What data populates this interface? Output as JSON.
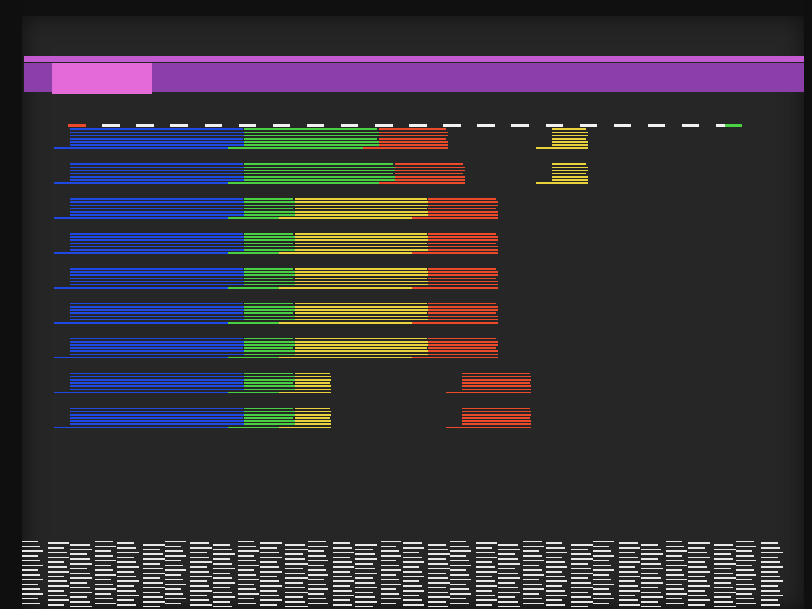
{
  "screen": {
    "title_bar": {
      "accent_color": "#c45ad0",
      "band_color": "#8c3fa8",
      "active_block_color": "#e36ad8"
    }
  },
  "colors": {
    "blue": "#1f49e6",
    "green": "#49d043",
    "yellow": "#e9d23b",
    "red": "#ec4a2a",
    "dash": "#f2f2f2",
    "background": "#262626"
  },
  "chart_data": {
    "type": "bar",
    "title": "",
    "xlabel": "",
    "ylabel": "",
    "stacked": true,
    "rows": [
      {
        "segments": [
          {
            "color": "blue",
            "start": 0,
            "length": 220
          },
          {
            "color": "green",
            "start": 220,
            "length": 170
          },
          {
            "color": "red",
            "start": 390,
            "length": 87
          }
        ],
        "floating": [
          {
            "color": "yellow",
            "start": 608,
            "length": 45
          }
        ]
      },
      {
        "segments": [
          {
            "color": "blue",
            "start": 0,
            "length": 220
          },
          {
            "color": "green",
            "start": 220,
            "length": 190
          },
          {
            "color": "red",
            "start": 410,
            "length": 88
          }
        ],
        "floating": [
          {
            "color": "yellow",
            "start": 608,
            "length": 45
          }
        ]
      },
      {
        "segments": [
          {
            "color": "blue",
            "start": 0,
            "length": 220
          },
          {
            "color": "green",
            "start": 220,
            "length": 64
          },
          {
            "color": "yellow",
            "start": 284,
            "length": 168
          },
          {
            "color": "red",
            "start": 452,
            "length": 88
          }
        ],
        "floating": []
      },
      {
        "segments": [
          {
            "color": "blue",
            "start": 0,
            "length": 220
          },
          {
            "color": "green",
            "start": 220,
            "length": 64
          },
          {
            "color": "yellow",
            "start": 284,
            "length": 168
          },
          {
            "color": "red",
            "start": 452,
            "length": 88
          }
        ],
        "floating": []
      },
      {
        "segments": [
          {
            "color": "blue",
            "start": 0,
            "length": 220
          },
          {
            "color": "green",
            "start": 220,
            "length": 64
          },
          {
            "color": "yellow",
            "start": 284,
            "length": 168
          },
          {
            "color": "red",
            "start": 452,
            "length": 88
          }
        ],
        "floating": []
      },
      {
        "segments": [
          {
            "color": "blue",
            "start": 0,
            "length": 220
          },
          {
            "color": "green",
            "start": 220,
            "length": 64
          },
          {
            "color": "yellow",
            "start": 284,
            "length": 168
          },
          {
            "color": "red",
            "start": 452,
            "length": 88
          }
        ],
        "floating": []
      },
      {
        "segments": [
          {
            "color": "blue",
            "start": 0,
            "length": 220
          },
          {
            "color": "green",
            "start": 220,
            "length": 64
          },
          {
            "color": "yellow",
            "start": 284,
            "length": 168
          },
          {
            "color": "red",
            "start": 452,
            "length": 88
          }
        ],
        "floating": []
      },
      {
        "segments": [
          {
            "color": "blue",
            "start": 0,
            "length": 220
          },
          {
            "color": "green",
            "start": 220,
            "length": 64
          },
          {
            "color": "yellow",
            "start": 284,
            "length": 46
          }
        ],
        "floating": [
          {
            "color": "red",
            "start": 494,
            "length": 88
          }
        ]
      },
      {
        "segments": [
          {
            "color": "blue",
            "start": 0,
            "length": 220
          },
          {
            "color": "green",
            "start": 220,
            "length": 64
          },
          {
            "color": "yellow",
            "start": 284,
            "length": 46
          }
        ],
        "floating": [
          {
            "color": "red",
            "start": 494,
            "length": 88
          }
        ]
      }
    ],
    "grid": false,
    "legend": "none"
  }
}
